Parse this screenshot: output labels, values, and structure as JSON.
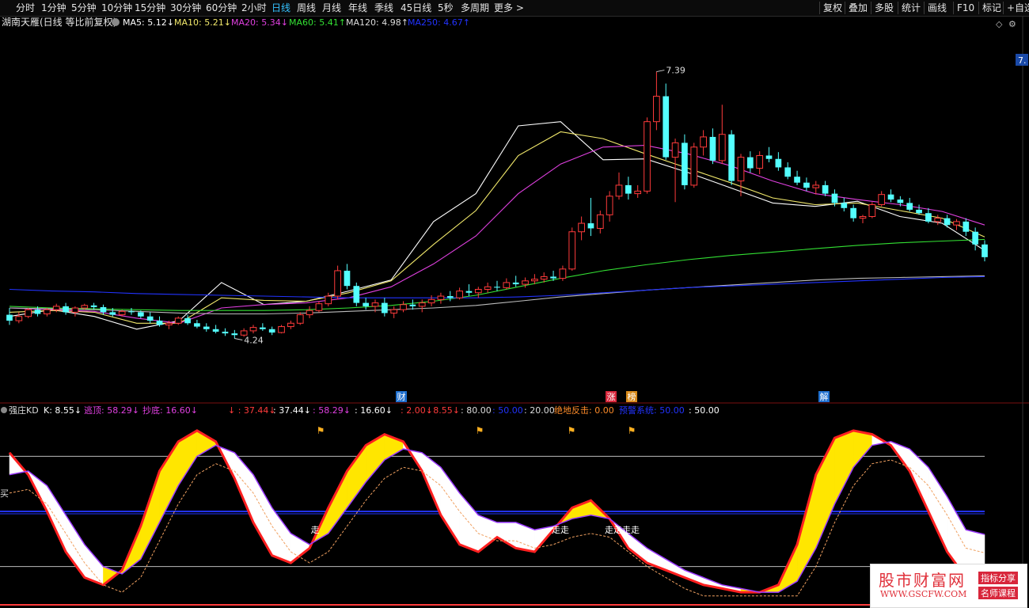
{
  "toolbar": {
    "periods": [
      "分时",
      "1分钟",
      "5分钟",
      "10分钟",
      "15分钟",
      "30分钟",
      "60分钟",
      "2小时",
      "日线",
      "周线",
      "月线",
      "年线",
      "季线",
      "45日线",
      "5秒",
      "多周期",
      "更多 >"
    ],
    "active_period": "日线",
    "right": [
      "复权",
      "叠加",
      "多股",
      "统计",
      "画线",
      "F10",
      "标记",
      "+自选"
    ]
  },
  "main_legend": {
    "title": "湖南天雁(日线 等比前复权)",
    "items": [
      {
        "label": "MA5: 5.12↓",
        "color": "#ffffff"
      },
      {
        "label": "MA10: 5.21↓",
        "color": "#f2e96b"
      },
      {
        "label": "MA20: 5.34↓",
        "color": "#e040e0"
      },
      {
        "label": "MA60: 5.41↑",
        "color": "#33e033"
      },
      {
        "label": "MA120: 4.98↑",
        "color": "#dddddd"
      },
      {
        "label": "MA250: 4.67↑",
        "color": "#2233ff"
      }
    ],
    "right_badge": "7."
  },
  "colors": {
    "up": "#ff3b3b",
    "down": "#54ffff",
    "bg": "#000000"
  },
  "chart_data": [
    {
      "type": "candlestick",
      "title": "湖南天雁(日线 等比前复权)",
      "price_range": [
        3.6,
        7.9
      ],
      "annotations": {
        "high": "7.39",
        "low": "4.24"
      },
      "event_markers": [
        "财",
        "涨",
        "榜",
        "解"
      ],
      "candles": [
        [
          4.52,
          4.6,
          4.4,
          4.45
        ],
        [
          4.45,
          4.55,
          4.42,
          4.5
        ],
        [
          4.5,
          4.6,
          4.48,
          4.58
        ],
        [
          4.58,
          4.62,
          4.5,
          4.53
        ],
        [
          4.53,
          4.6,
          4.5,
          4.58
        ],
        [
          4.58,
          4.65,
          4.55,
          4.62
        ],
        [
          4.62,
          4.66,
          4.52,
          4.55
        ],
        [
          4.55,
          4.62,
          4.5,
          4.6
        ],
        [
          4.6,
          4.65,
          4.58,
          4.63
        ],
        [
          4.63,
          4.66,
          4.58,
          4.61
        ],
        [
          4.61,
          4.64,
          4.52,
          4.55
        ],
        [
          4.55,
          4.6,
          4.5,
          4.52
        ],
        [
          4.52,
          4.58,
          4.5,
          4.56
        ],
        [
          4.56,
          4.6,
          4.52,
          4.55
        ],
        [
          4.55,
          4.57,
          4.48,
          4.5
        ],
        [
          4.5,
          4.55,
          4.42,
          4.45
        ],
        [
          4.45,
          4.5,
          4.38,
          4.4
        ],
        [
          4.4,
          4.45,
          4.35,
          4.42
        ],
        [
          4.42,
          4.5,
          4.4,
          4.48
        ],
        [
          4.48,
          4.52,
          4.4,
          4.42
        ],
        [
          4.42,
          4.46,
          4.36,
          4.38
        ],
        [
          4.38,
          4.42,
          4.32,
          4.35
        ],
        [
          4.35,
          4.4,
          4.3,
          4.32
        ],
        [
          4.32,
          4.36,
          4.27,
          4.3
        ],
        [
          4.3,
          4.34,
          4.24,
          4.28
        ],
        [
          4.28,
          4.36,
          4.26,
          4.33
        ],
        [
          4.33,
          4.4,
          4.3,
          4.37
        ],
        [
          4.37,
          4.42,
          4.33,
          4.35
        ],
        [
          4.35,
          4.38,
          4.28,
          4.31
        ],
        [
          4.31,
          4.4,
          4.3,
          4.38
        ],
        [
          4.38,
          4.45,
          4.35,
          4.42
        ],
        [
          4.42,
          4.55,
          4.4,
          4.52
        ],
        [
          4.52,
          4.62,
          4.48,
          4.57
        ],
        [
          4.57,
          4.68,
          4.55,
          4.65
        ],
        [
          4.65,
          4.78,
          4.62,
          4.74
        ],
        [
          4.74,
          5.1,
          4.7,
          5.04
        ],
        [
          5.04,
          5.12,
          4.82,
          4.86
        ],
        [
          4.86,
          4.9,
          4.62,
          4.66
        ],
        [
          4.66,
          4.72,
          4.58,
          4.62
        ],
        [
          4.62,
          4.7,
          4.55,
          4.66
        ],
        [
          4.66,
          4.72,
          4.5,
          4.54
        ],
        [
          4.54,
          4.62,
          4.48,
          4.58
        ],
        [
          4.58,
          4.68,
          4.55,
          4.64
        ],
        [
          4.64,
          4.7,
          4.58,
          4.62
        ],
        [
          4.62,
          4.7,
          4.55,
          4.66
        ],
        [
          4.66,
          4.75,
          4.62,
          4.7
        ],
        [
          4.7,
          4.78,
          4.65,
          4.74
        ],
        [
          4.74,
          4.8,
          4.68,
          4.72
        ],
        [
          4.72,
          4.84,
          4.7,
          4.8
        ],
        [
          4.8,
          4.88,
          4.74,
          4.78
        ],
        [
          4.78,
          4.85,
          4.72,
          4.82
        ],
        [
          4.82,
          4.9,
          4.78,
          4.85
        ],
        [
          4.85,
          4.92,
          4.8,
          4.84
        ],
        [
          4.84,
          4.95,
          4.82,
          4.9
        ],
        [
          4.9,
          4.98,
          4.85,
          4.88
        ],
        [
          4.88,
          4.96,
          4.84,
          4.92
        ],
        [
          4.92,
          5.0,
          4.88,
          4.94
        ],
        [
          4.94,
          5.02,
          4.9,
          4.97
        ],
        [
          4.97,
          5.04,
          4.92,
          4.95
        ],
        [
          4.95,
          5.1,
          4.92,
          5.06
        ],
        [
          5.06,
          5.55,
          5.04,
          5.5
        ],
        [
          5.5,
          5.68,
          5.4,
          5.6
        ],
        [
          5.6,
          5.9,
          5.45,
          5.54
        ],
        [
          5.54,
          5.75,
          5.48,
          5.7
        ],
        [
          5.7,
          5.98,
          5.62,
          5.92
        ],
        [
          5.92,
          6.2,
          5.88,
          6.05
        ],
        [
          6.05,
          6.15,
          5.88,
          5.95
        ],
        [
          5.95,
          6.05,
          5.9,
          5.98
        ],
        [
          5.98,
          6.85,
          5.95,
          6.8
        ],
        [
          6.8,
          7.39,
          6.7,
          7.1
        ],
        [
          7.1,
          7.25,
          6.35,
          6.38
        ],
        [
          6.38,
          6.6,
          5.85,
          6.55
        ],
        [
          6.55,
          6.65,
          6.0,
          6.05
        ],
        [
          6.05,
          6.55,
          6.02,
          6.5
        ],
        [
          6.5,
          6.7,
          6.4,
          6.62
        ],
        [
          6.62,
          6.72,
          6.3,
          6.34
        ],
        [
          6.34,
          7.0,
          6.3,
          6.65
        ],
        [
          6.65,
          6.7,
          6.05,
          6.1
        ],
        [
          6.1,
          6.42,
          5.92,
          6.38
        ],
        [
          6.38,
          6.45,
          6.2,
          6.25
        ],
        [
          6.25,
          6.45,
          6.18,
          6.4
        ],
        [
          6.4,
          6.5,
          6.32,
          6.36
        ],
        [
          6.36,
          6.44,
          6.22,
          6.26
        ],
        [
          6.26,
          6.32,
          6.12,
          6.15
        ],
        [
          6.15,
          6.22,
          6.05,
          6.08
        ],
        [
          6.08,
          6.14,
          5.98,
          6.02
        ],
        [
          6.02,
          6.1,
          5.94,
          6.05
        ],
        [
          6.05,
          6.1,
          5.92,
          5.95
        ],
        [
          5.95,
          6.0,
          5.8,
          5.84
        ],
        [
          5.84,
          5.9,
          5.74,
          5.78
        ],
        [
          5.78,
          5.82,
          5.62,
          5.66
        ],
        [
          5.66,
          5.7,
          5.6,
          5.68
        ],
        [
          5.68,
          5.85,
          5.66,
          5.82
        ],
        [
          5.82,
          5.98,
          5.8,
          5.94
        ],
        [
          5.94,
          6.0,
          5.85,
          5.88
        ],
        [
          5.88,
          5.92,
          5.8,
          5.84
        ],
        [
          5.84,
          5.9,
          5.74,
          5.76
        ],
        [
          5.76,
          5.82,
          5.7,
          5.72
        ],
        [
          5.72,
          5.78,
          5.6,
          5.62
        ],
        [
          5.62,
          5.7,
          5.58,
          5.66
        ],
        [
          5.66,
          5.7,
          5.55,
          5.58
        ],
        [
          5.58,
          5.65,
          5.52,
          5.62
        ],
        [
          5.62,
          5.66,
          5.45,
          5.5
        ],
        [
          5.5,
          5.55,
          5.28,
          5.35
        ],
        [
          5.35,
          5.4,
          5.15,
          5.2
        ]
      ],
      "moving_averages": {
        "MA5": [
          4.5,
          4.58,
          4.5,
          4.35,
          4.45,
          4.9,
          4.64,
          4.68,
          4.8,
          4.93,
          5.62,
          5.95,
          6.75,
          6.8,
          6.35,
          6.36,
          6.2,
          6.02,
          5.84,
          5.8,
          5.86,
          5.68,
          5.6,
          5.28
        ],
        "MA10": [
          4.55,
          4.57,
          4.55,
          4.42,
          4.42,
          4.72,
          4.69,
          4.68,
          4.78,
          4.92,
          5.35,
          5.75,
          6.4,
          6.68,
          6.6,
          6.42,
          6.25,
          6.08,
          5.9,
          5.82,
          5.84,
          5.75,
          5.66,
          5.44
        ],
        "MA20": [
          4.6,
          4.58,
          4.56,
          4.48,
          4.42,
          4.6,
          4.64,
          4.66,
          4.72,
          4.85,
          5.12,
          5.45,
          5.95,
          6.3,
          6.5,
          6.52,
          6.42,
          6.28,
          6.1,
          5.95,
          5.88,
          5.82,
          5.74,
          5.58
        ],
        "MA60": [
          4.62,
          4.6,
          4.59,
          4.58,
          4.57,
          4.57,
          4.57,
          4.58,
          4.6,
          4.63,
          4.68,
          4.75,
          4.85,
          4.95,
          5.04,
          5.11,
          5.17,
          5.22,
          5.26,
          5.3,
          5.34,
          5.37,
          5.39,
          5.41
        ],
        "MA120": [
          4.6,
          4.59,
          4.58,
          4.56,
          4.54,
          4.53,
          4.53,
          4.54,
          4.56,
          4.58,
          4.6,
          4.63,
          4.68,
          4.73,
          4.77,
          4.81,
          4.84,
          4.87,
          4.9,
          4.93,
          4.95,
          4.96,
          4.97,
          4.98
        ],
        "MA250": [
          4.82,
          4.8,
          4.79,
          4.77,
          4.76,
          4.75,
          4.74,
          4.73,
          4.72,
          4.72,
          4.72,
          4.72,
          4.73,
          4.75,
          4.78,
          4.81,
          4.84,
          4.86,
          4.88,
          4.9,
          4.92,
          4.94,
          4.96,
          4.97
        ]
      }
    },
    {
      "type": "line",
      "title": "强庄KD",
      "y_range": [
        0,
        100
      ],
      "levels": [
        80,
        20
      ],
      "level_band": [
        50,
        58
      ],
      "legend_items": [
        {
          "label": "K: 8.55↓",
          "color": "#ffffff"
        },
        {
          "label": "逃顶: 58.29↓",
          "color": "#e040e0"
        },
        {
          "label": "抄底: 16.60↓",
          "color": "#e040e0"
        },
        {
          "label": "↓ : 37.44↓",
          "color": "#ff3b3b"
        },
        {
          "label": ": 37.44↓",
          "color": "#ffffff"
        },
        {
          "label": ": 58.29↓",
          "color": "#e040e0"
        },
        {
          "label": ": 16.60↓",
          "color": "#ffffff"
        },
        {
          "label": ": 2.00↓",
          "color": "#ff3b3b"
        },
        {
          "label": ": 8.55↓",
          "color": "#ff3b3b"
        },
        {
          "label": ": 80.00",
          "color": "#dddddd"
        },
        {
          "label": ": 50.00",
          "color": "#2233ff"
        },
        {
          "label": ": 20.00",
          "color": "#dddddd"
        },
        {
          "label": "绝地反击: 0.00",
          "color": "#ff8c2a"
        },
        {
          "label": "预警系统: 50.00",
          "color": "#2233ff"
        },
        {
          "label": ": 50.00",
          "color": "#ffffff"
        }
      ],
      "buy_label": "买",
      "sell_labels": [
        "走",
        "走走",
        "走走走走"
      ],
      "k": [
        82,
        70,
        50,
        28,
        14,
        10,
        18,
        42,
        72,
        88,
        94,
        88,
        68,
        44,
        26,
        22,
        30,
        52,
        72,
        86,
        92,
        88,
        72,
        48,
        32,
        28,
        36,
        30,
        28,
        40,
        52,
        56,
        46,
        30,
        22,
        18,
        14,
        10,
        8,
        6,
        6,
        10,
        32,
        70,
        90,
        94,
        92,
        86,
        72,
        50,
        28,
        14,
        8.55
      ],
      "d": [
        70,
        72,
        64,
        48,
        32,
        20,
        16,
        24,
        44,
        64,
        80,
        86,
        82,
        70,
        52,
        38,
        32,
        38,
        52,
        66,
        78,
        84,
        82,
        74,
        60,
        48,
        44,
        44,
        40,
        42,
        46,
        48,
        46,
        38,
        30,
        24,
        18,
        14,
        10,
        8,
        6,
        6,
        12,
        30,
        54,
        74,
        86,
        88,
        84,
        74,
        58,
        40,
        37.44
      ]
    }
  ],
  "watermark": {
    "title": "股市财富网",
    "url": "WWW.GSCFW.COM",
    "tag1": "指标分享",
    "tag2": "名师课程"
  }
}
